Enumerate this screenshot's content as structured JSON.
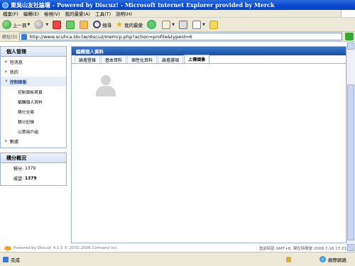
{
  "window": {
    "title": "東吳山友社論壇 - Powered by Discuz! - Microsoft Internet Explorer provided by Merck"
  },
  "menubar": {
    "items": [
      "檔案(F)",
      "編輯(E)",
      "檢視(V)",
      "我的最愛(A)",
      "工具(T)",
      "說明(H)"
    ]
  },
  "toolbar": {
    "back_label": "上一頁",
    "search_label": "搜尋",
    "favorites_label": "我的最愛"
  },
  "address": {
    "label": "網址(D)",
    "url": "http://www.scuhca.idv.tw/discuz/memcp.php?action=profile&typeid=6"
  },
  "sidebar": {
    "title": "個人管理",
    "items": [
      {
        "label": "短消息"
      },
      {
        "label": "我的"
      },
      {
        "label": "控制面板"
      },
      {
        "label": "數據"
      }
    ],
    "subitems": [
      "控制面板首頁",
      "編輯個人資料",
      "積分交易",
      "積分記錄",
      "公眾用戶組"
    ]
  },
  "scorebox": {
    "title": "積分概況",
    "points_label": "積分:",
    "points_value": "1379",
    "money_label": "威望:",
    "money_value": "1379"
  },
  "main": {
    "title": "編輯個人資料",
    "tabs": [
      "論壇登錄",
      "基本資料",
      "個性化資料",
      "論壇選項",
      "上傳頭像"
    ],
    "active_tab": "上傳頭像"
  },
  "footer": {
    "left": "Powered by Discuz! 4.1.0 © 2001-2006 Comsenz Inc.",
    "right": "當前時區 GMT+8, 現在時間是 2008-7-16 17:21"
  },
  "statusbar": {
    "text": "完成",
    "zone": "網際網路"
  }
}
